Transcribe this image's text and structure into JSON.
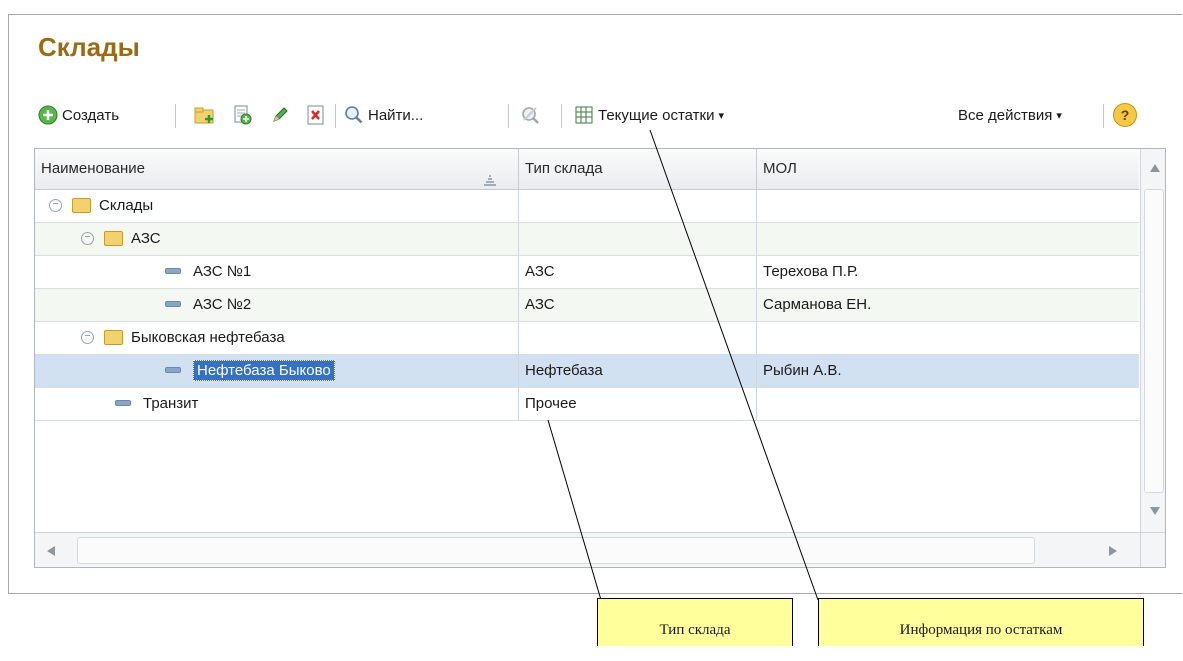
{
  "window": {
    "title": "Склады"
  },
  "toolbar": {
    "create_label": "Создать",
    "find_label": "Найти...",
    "balances_label": "Текущие остатки",
    "all_actions_label": "Все действия",
    "help_symbol": "?",
    "dropdown_arrow": "▾"
  },
  "table": {
    "columns": [
      "Наименование",
      "Тип склада",
      "МОЛ"
    ],
    "rows": [
      {
        "name": "Склады",
        "type": "",
        "mol": ""
      },
      {
        "name": "АЗС",
        "type": "",
        "mol": ""
      },
      {
        "name": "АЗС №1",
        "type": "АЗС",
        "mol": "Терехова П.Р."
      },
      {
        "name": "АЗС №2",
        "type": "АЗС",
        "mol": "Сарманова ЕН."
      },
      {
        "name": "Быковская нефтебаза",
        "type": "",
        "mol": ""
      },
      {
        "name": "Нефтебаза Быково",
        "type": "Нефтебаза",
        "mol": "Рыбин А.В."
      },
      {
        "name": "Транзит",
        "type": "Прочее",
        "mol": ""
      }
    ]
  },
  "annotations": {
    "warehouse_type": "Тип склада",
    "balances_info": "Информация по  остаткам"
  },
  "icons": [
    "create-icon",
    "new-folder-icon",
    "copy-icon",
    "edit-icon",
    "delete-icon",
    "search-icon",
    "clear-search-icon",
    "balances-table-icon",
    "help-icon",
    "folder-icon",
    "collapse-icon",
    "item-icon",
    "sort-icon"
  ],
  "colors": {
    "title": "#9b6b14",
    "selected_row": "#d2e1f2",
    "alt_row": "#f3f8f3",
    "callout": "#ffff9b"
  }
}
